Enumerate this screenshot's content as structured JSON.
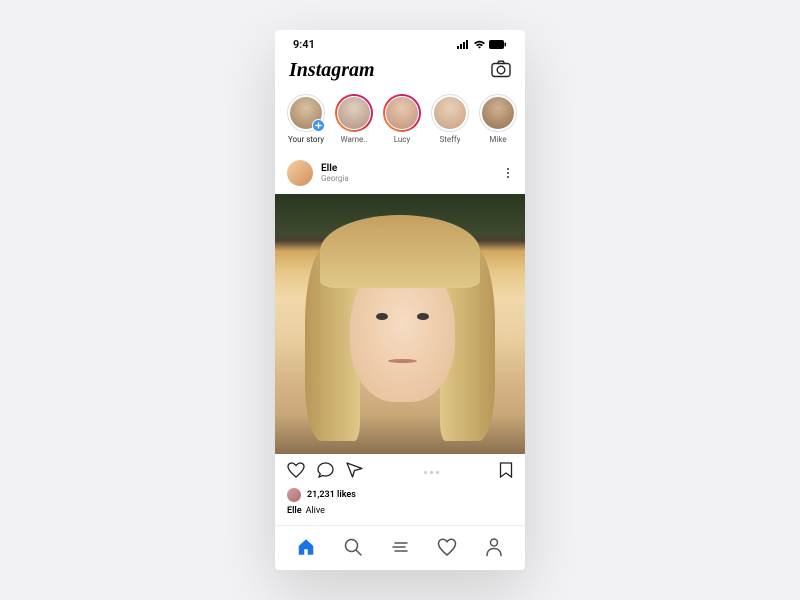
{
  "status": {
    "time": "9:41"
  },
  "header": {
    "logo": "Instagram"
  },
  "stories": [
    {
      "label": "Your story",
      "mine": true
    },
    {
      "label": "Warne.."
    },
    {
      "label": "Lucy"
    },
    {
      "label": "Steffy"
    },
    {
      "label": "Mike"
    }
  ],
  "post": {
    "username": "Elle",
    "location": "Georgia",
    "likes": "21,231 likes",
    "caption_user": "Elle",
    "caption_text": "Alive"
  }
}
